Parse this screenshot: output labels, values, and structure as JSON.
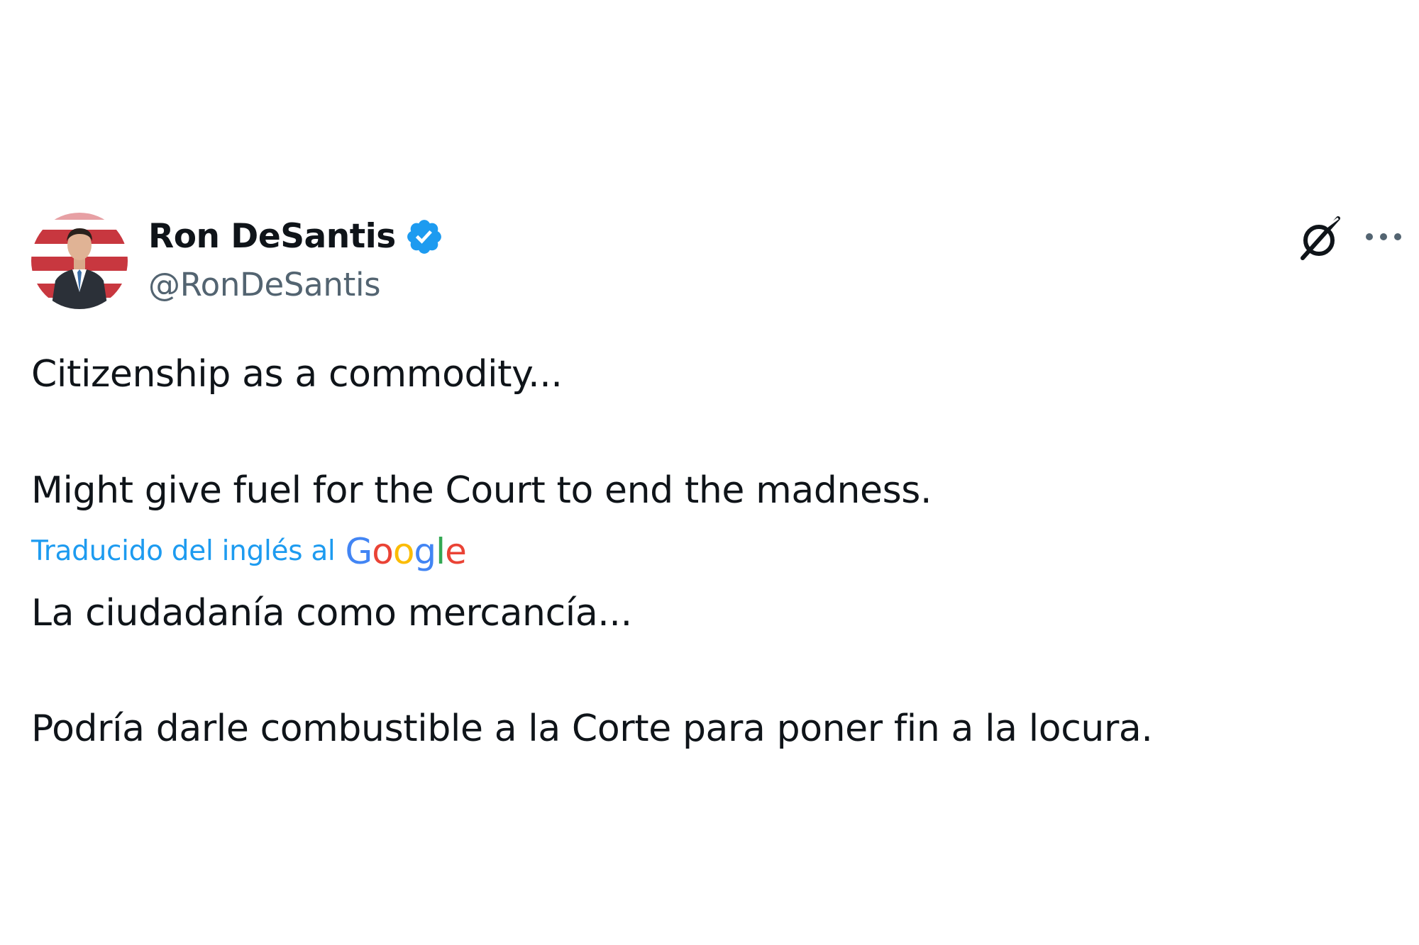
{
  "author": {
    "display_name": "Ron DeSantis",
    "handle": "@RonDeSantis",
    "verified": true,
    "avatar_icon": "profile-photo"
  },
  "header_actions": {
    "grok_icon": "grok-icon",
    "more_icon": "more-options-icon"
  },
  "tweet": {
    "original_line_1": "Citizenship as a commodity...",
    "original_line_2": "Might give fuel for the Court to end the madness.",
    "translated_by_label": "Traducido del inglés al",
    "translation_provider": "Google",
    "translated_line_1": "La ciudadanía como mercancía...",
    "translated_line_2": "Podría darle combustible a la Corte para poner fin a la locura."
  },
  "colors": {
    "text_primary": "#0f1419",
    "text_secondary": "#536471",
    "link_blue": "#1d9bf0",
    "verified_blue": "#1d9bf0",
    "google_blue": "#4285F4",
    "google_red": "#EA4335",
    "google_yellow": "#FBBC05",
    "google_green": "#34A853"
  }
}
